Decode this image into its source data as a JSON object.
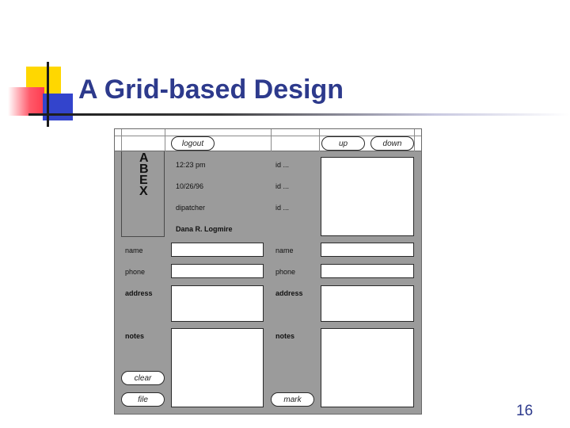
{
  "slide": {
    "title": "A Grid-based Design",
    "number": "16"
  },
  "mockup": {
    "buttons": {
      "logout": "logout",
      "up": "up",
      "down": "down",
      "clear": "clear",
      "file": "file",
      "mark": "mark"
    },
    "logo_letters": [
      "A",
      "B",
      "E",
      "X"
    ],
    "info": {
      "time": "12:23 pm",
      "date": "10/26/96",
      "role": "dipatcher",
      "user": "Dana R. Logmire",
      "id1": "id ...",
      "id2": "id ...",
      "id3": "id ..."
    },
    "left_form": {
      "name": "name",
      "phone": "phone",
      "address": "address",
      "notes": "notes"
    },
    "right_form": {
      "name": "name",
      "phone": "phone",
      "address": "address",
      "notes": "notes"
    }
  }
}
